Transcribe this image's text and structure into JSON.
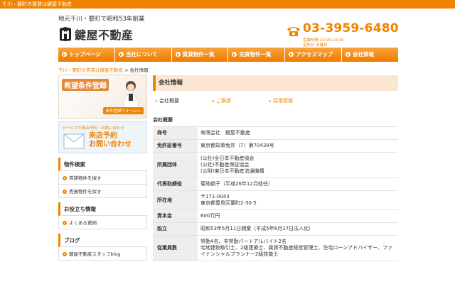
{
  "topbar": {
    "text": "千川・要町の賃貸は鍵屋不動産"
  },
  "header": {
    "tagline": "地元千川・要町で昭和53年創業",
    "logo_text": "鍵屋不動産",
    "phone": "03-3959-6480",
    "hours_line1": "営業時間 10:00-19:00",
    "hours_line2": "定休日 水曜日"
  },
  "nav": {
    "items": [
      {
        "label": "トップページ"
      },
      {
        "label": "当社について"
      },
      {
        "label": "賃貸物件一覧"
      },
      {
        "label": "売買物件一覧"
      },
      {
        "label": "アクセスマップ"
      },
      {
        "label": "会社情報"
      }
    ]
  },
  "breadcrumb": {
    "home": "千川・要町の賃貸は鍵屋不動産",
    "sep": " > ",
    "current": "会社情報"
  },
  "sidebar": {
    "banner1_title": "希望条件登録",
    "banner1_sub": "条件登録フォームへ",
    "banner2_top": "メールでの来店予約・お問い合わせ",
    "banner2_main1": "来店予約",
    "banner2_main2": "お問い合わせ",
    "sections": [
      {
        "heading": "物件検索",
        "items": [
          "賃貸物件を探す",
          "売買物件を探す"
        ]
      },
      {
        "heading": "お役立ち情報",
        "items": [
          "よくある質問"
        ]
      },
      {
        "heading": "ブログ",
        "items": [
          "鍵屋不動産スタッフblog"
        ]
      }
    ]
  },
  "main": {
    "title": "会社情報",
    "tabs": [
      "会社概要",
      "ご挨拶",
      "採用情報"
    ],
    "section_heading": "会社概要",
    "rows": [
      {
        "label": "商号",
        "lines": [
          "有限会社　鍵屋不動産"
        ]
      },
      {
        "label": "免許証番号",
        "lines": [
          "東京都知事免許（7）第70439号"
        ]
      },
      {
        "label": "所属団体",
        "lines": [
          "(公社)全日本不動産協会",
          "(公社)不動産保証協会",
          "(公財)東日本不動産流通機構"
        ]
      },
      {
        "label": "代表取締役",
        "lines": [
          "菊地朝子（平成26年12月就任）"
        ]
      },
      {
        "label": "所在地",
        "lines": [
          "〒171-0043",
          "東京都豊島区要町2-30-5"
        ]
      },
      {
        "label": "資本金",
        "lines": [
          "600万円"
        ]
      },
      {
        "label": "設立",
        "lines": [
          "昭和53年5月11日開業（平成5年6月17日法人化）"
        ]
      },
      {
        "label": "従業員数",
        "lines": [
          "常勤4名、非常勤パートアルバイト2名",
          "宅地建物取引士、2級建築士、賃貸不動産経営管理士、住宅ローンアドバイザー、ファイナンシャルプランナー2級技能士"
        ]
      }
    ]
  }
}
